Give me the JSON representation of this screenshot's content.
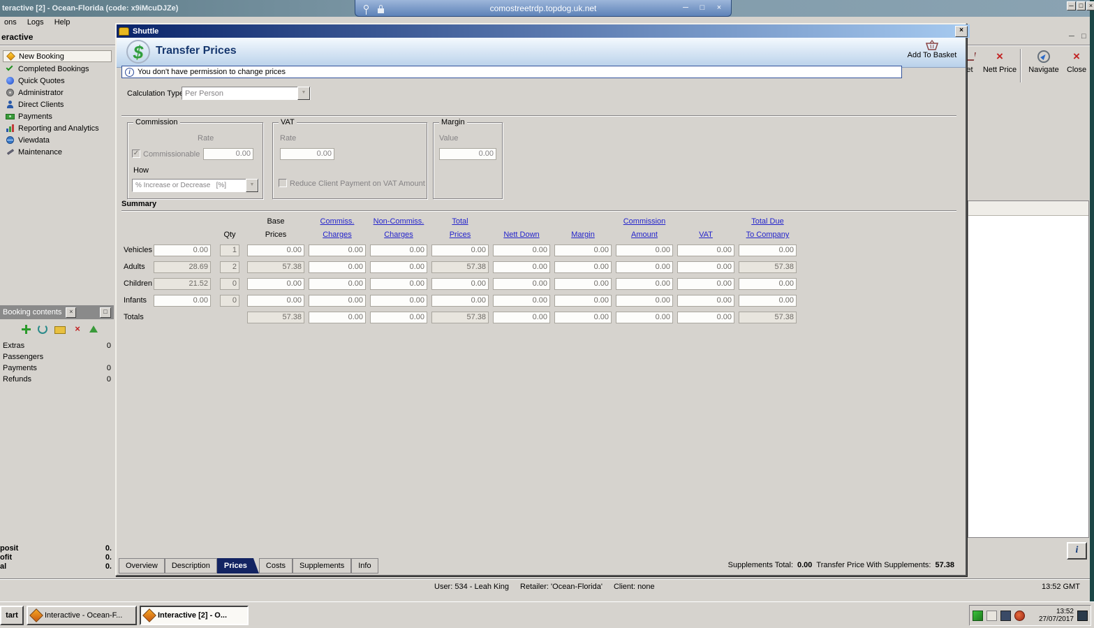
{
  "colors": {
    "titlebar_active_start": "#0a246a",
    "titlebar_active_end": "#a6caf0",
    "window_gray": "#d6d3ce",
    "link_blue": "#2323cc",
    "heading_navy": "#16376e",
    "active_tab_navy": "#132462",
    "info_border_blue": "#31519a",
    "dollar_green": "#2f9e3f"
  },
  "icons": {
    "minimize": "─",
    "maximize": "□",
    "close_glyph": "×",
    "dropdown_arrow": "▼",
    "checkmark": "✓",
    "info_i": "i",
    "dollar": "$",
    "delete_x": "×"
  },
  "window": {
    "title": "teractive [2] - Ocean-Florida (code: x9iMcuDJZe)",
    "rdp_host": "comostreetrdp.topdog.uk.net"
  },
  "menubar": {
    "items": [
      "ons",
      "Logs",
      "Help"
    ]
  },
  "sidebar": {
    "header": "eractive",
    "items": [
      {
        "label": "New Booking"
      },
      {
        "label": "Completed Bookings"
      },
      {
        "label": "Quick Quotes"
      },
      {
        "label": "Administrator"
      },
      {
        "label": "Direct Clients"
      },
      {
        "label": "Payments"
      },
      {
        "label": "Reporting and Analytics"
      },
      {
        "label": "Viewdata"
      },
      {
        "label": "Maintenance"
      }
    ]
  },
  "booking_panel": {
    "title": "Booking contents",
    "rows": [
      {
        "label": "Extras",
        "value": "0"
      },
      {
        "label": "Passengers",
        "value": ""
      },
      {
        "label": "Payments",
        "value": "0"
      },
      {
        "label": "Refunds",
        "value": "0"
      }
    ]
  },
  "bottom_totals": [
    {
      "label": "posit",
      "value": "0."
    },
    {
      "label": "ofit",
      "value": "0."
    },
    {
      "label": "al",
      "value": "0."
    }
  ],
  "main_toolbar": {
    "basket_label": "et",
    "nett_price_label": "Nett Price",
    "navigate_label": "Navigate",
    "close_label": "Close"
  },
  "statusbar": {
    "user": "User: 534 - Leah King",
    "retailer": "Retailer: 'Ocean-Florida'",
    "client": "Client: none",
    "time": "13:52 GMT"
  },
  "dialog": {
    "title": "Shuttle",
    "heading": "Transfer Prices",
    "add_to_basket": "Add To Basket",
    "info_message": "You don't have permission to change prices",
    "calc_type": {
      "label": "Calculation Type",
      "value": "Per Person"
    },
    "commission": {
      "title": "Commission",
      "rate_label": "Rate",
      "commissionable_label": "Commissionable",
      "rate_value": "0.00",
      "how_label": "How",
      "how_value": "% Increase or Decrease   [%]"
    },
    "vat": {
      "title": "VAT",
      "rate_label": "Rate",
      "rate_value": "0.00",
      "reduce_label": "Reduce Client Payment on VAT Amount"
    },
    "margin": {
      "title": "Margin",
      "value_label": "Value",
      "value": "0.00"
    },
    "summary": {
      "title": "Summary",
      "headers": {
        "qty": "Qty",
        "base1": "Base",
        "base2": "Prices",
        "comm1": "Commiss.",
        "comm2": "Charges",
        "noncomm1": "Non-Commiss.",
        "noncomm2": "Charges",
        "total1": "Total",
        "total2": "Prices",
        "nett": "Nett Down",
        "margin": "Margin",
        "commamt1": "Commission",
        "commamt2": "Amount",
        "vat": "VAT",
        "due1": "Total Due",
        "due2": "To Company"
      },
      "rows": {
        "vehicles": {
          "label": "Vehicles",
          "unit": "0.00",
          "qty": "1",
          "base": "0.00",
          "comm": "0.00",
          "noncomm": "0.00",
          "total": "0.00",
          "nett": "0.00",
          "margin": "0.00",
          "commamt": "0.00",
          "vat": "0.00",
          "due": "0.00"
        },
        "adults": {
          "label": "Adults",
          "unit": "28.69",
          "qty": "2",
          "base": "57.38",
          "comm": "0.00",
          "noncomm": "0.00",
          "total": "57.38",
          "nett": "0.00",
          "margin": "0.00",
          "commamt": "0.00",
          "vat": "0.00",
          "due": "57.38"
        },
        "children": {
          "label": "Children",
          "unit": "21.52",
          "qty": "0",
          "base": "0.00",
          "comm": "0.00",
          "noncomm": "0.00",
          "total": "0.00",
          "nett": "0.00",
          "margin": "0.00",
          "commamt": "0.00",
          "vat": "0.00",
          "due": "0.00"
        },
        "infants": {
          "label": "Infants",
          "unit": "0.00",
          "qty": "0",
          "base": "0.00",
          "comm": "0.00",
          "noncomm": "0.00",
          "total": "0.00",
          "nett": "0.00",
          "margin": "0.00",
          "commamt": "0.00",
          "vat": "0.00",
          "due": "0.00"
        },
        "totals": {
          "label": "Totals",
          "base": "57.38",
          "comm": "0.00",
          "noncomm": "0.00",
          "total": "57.38",
          "nett": "0.00",
          "margin": "0.00",
          "commamt": "0.00",
          "vat": "0.00",
          "due": "57.38"
        }
      }
    },
    "tabs": [
      {
        "label": "Overview"
      },
      {
        "label": "Description"
      },
      {
        "label": "Prices"
      },
      {
        "label": "Costs"
      },
      {
        "label": "Supplements"
      },
      {
        "label": "Info"
      }
    ],
    "footer": {
      "supplements_total_label": "Supplements Total:",
      "supplements_total": "0.00",
      "transfer_price_label": "Transfer Price With Supplements:",
      "transfer_price": "57.38"
    }
  },
  "taskbar": {
    "start": "tart",
    "items": [
      {
        "label": "Interactive - Ocean-F..."
      },
      {
        "label": "Interactive [2] - O..."
      }
    ],
    "clock": {
      "time": "13:52",
      "date": "27/07/2017"
    }
  }
}
